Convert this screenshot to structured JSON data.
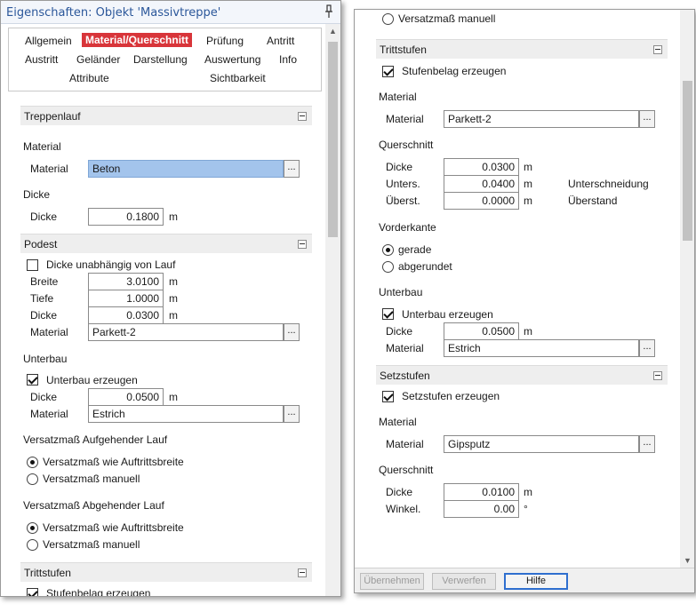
{
  "left": {
    "title": "Eigenschaften: Objekt 'Massivtreppe'",
    "tabs": [
      "Allgemein",
      "Material/Querschnitt",
      "Prüfung",
      "Antritt",
      "Austritt",
      "Geländer",
      "Darstellung",
      "Auswertung",
      "Info",
      "Attribute",
      "Sichtbarkeit"
    ],
    "treppenlauf": {
      "header": "Treppenlauf",
      "material_heading": "Material",
      "material_label": "Material",
      "material_value": "Beton",
      "dicke_heading": "Dicke",
      "dicke_label": "Dicke",
      "dicke_value": "0.1800",
      "dicke_unit": "m"
    },
    "podest": {
      "header": "Podest",
      "checkbox_label": "Dicke unabhängig von Lauf",
      "breite_label": "Breite",
      "breite_value": "3.0100",
      "breite_unit": "m",
      "tiefe_label": "Tiefe",
      "tiefe_value": "1.0000",
      "tiefe_unit": "m",
      "dicke_label": "Dicke",
      "dicke_value": "0.0300",
      "dicke_unit": "m",
      "material_label": "Material",
      "material_value": "Parkett-2"
    },
    "unterbau": {
      "heading": "Unterbau",
      "checkbox_label": "Unterbau erzeugen",
      "dicke_label": "Dicke",
      "dicke_value": "0.0500",
      "dicke_unit": "m",
      "material_label": "Material",
      "material_value": "Estrich"
    },
    "versatz_auf": {
      "heading": "Versatzmaß Aufgehender Lauf",
      "option1": "Versatzmaß wie Auftrittsbreite",
      "option2": "Versatzmaß manuell"
    },
    "versatz_ab": {
      "heading": "Versatzmaß Abgehender Lauf",
      "option1": "Versatzmaß wie Auftrittsbreite",
      "option2": "Versatzmaß manuell"
    },
    "trittstufen": {
      "header": "Trittstufen",
      "checkbox_label": "Stufenbelag erzeugen"
    }
  },
  "right": {
    "top_partial": "Versatzmaß manuell",
    "trittstufen": {
      "header": "Trittstufen",
      "checkbox_label": "Stufenbelag erzeugen",
      "material_heading": "Material",
      "material_label": "Material",
      "material_value": "Parkett-2",
      "querschnitt_heading": "Querschnitt",
      "dicke_label": "Dicke",
      "dicke_value": "0.0300",
      "dicke_unit": "m",
      "unters_label": "Unters.",
      "unters_value": "0.0400",
      "unters_unit": "m",
      "unters_desc": "Unterschneidung",
      "uebers_label": "Überst.",
      "uebers_value": "0.0000",
      "uebers_unit": "m",
      "uebers_desc": "Überstand",
      "vorderkante_heading": "Vorderkante",
      "radio1": "gerade",
      "radio2": "abgerundet",
      "unterbau_heading": "Unterbau",
      "unterbau_checkbox": "Unterbau erzeugen",
      "ub_dicke_label": "Dicke",
      "ub_dicke_value": "0.0500",
      "ub_dicke_unit": "m",
      "ub_material_label": "Material",
      "ub_material_value": "Estrich"
    },
    "setzstufen": {
      "header": "Setzstufen",
      "checkbox_label": "Setzstufen erzeugen",
      "material_heading": "Material",
      "material_label": "Material",
      "material_value": "Gipsputz",
      "querschnitt_heading": "Querschnitt",
      "dicke_label": "Dicke",
      "dicke_value": "0.0100",
      "dicke_unit": "m",
      "winkel_label": "Winkel.",
      "winkel_value": "0.00",
      "winkel_unit": "°"
    },
    "buttons": {
      "apply": "Übernehmen",
      "discard": "Verwerfen",
      "help": "Hilfe"
    }
  },
  "dots_label": "..."
}
